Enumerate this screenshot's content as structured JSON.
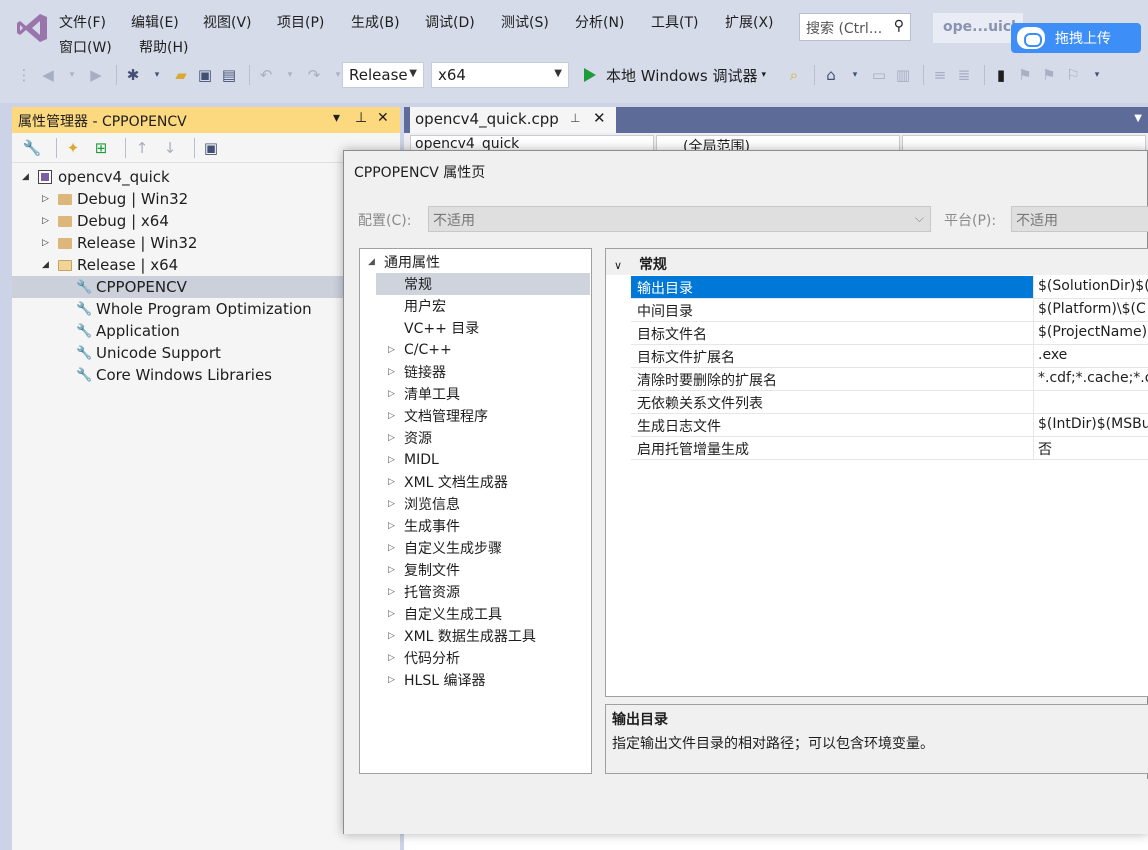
{
  "menu": [
    "文件(F)",
    "编辑(E)",
    "视图(V)",
    "项目(P)",
    "生成(B)",
    "调试(D)",
    "测试(S)",
    "分析(N)",
    "工具(T)",
    "扩展(X)",
    "窗口(W)",
    "帮助(H)"
  ],
  "search": {
    "placeholder": "搜索 (Ctrl..."
  },
  "project_badge": "ope...uick",
  "upload_button": "拖拽上传",
  "toolbar": {
    "configuration": "Release",
    "platform": "x64",
    "run_label": "本地 Windows 调试器"
  },
  "property_manager": {
    "title": "属性管理器 - CPPOPENCV",
    "pin": "ᵖ",
    "close": "✕",
    "tree": [
      {
        "label": "opencv4_quick",
        "type": "project",
        "expanded": true
      },
      {
        "label": "Debug | Win32",
        "type": "folder",
        "expanded": false
      },
      {
        "label": "Debug | x64",
        "type": "folder",
        "expanded": false
      },
      {
        "label": "Release | Win32",
        "type": "folder",
        "expanded": false
      },
      {
        "label": "Release | x64",
        "type": "folder",
        "expanded": true
      },
      {
        "label": "CPPOPENCV",
        "type": "sheet",
        "selected": true
      },
      {
        "label": "Whole Program Optimization",
        "type": "sheet"
      },
      {
        "label": "Application",
        "type": "sheet"
      },
      {
        "label": "Unicode Support",
        "type": "sheet"
      },
      {
        "label": "Core Windows Libraries",
        "type": "sheet"
      }
    ]
  },
  "editor": {
    "tab_label": "opencv4_quick.cpp",
    "nav_left": "opencv4_quick",
    "nav_mid": "(全局范围)"
  },
  "dialog": {
    "title": "CPPOPENCV 属性页",
    "config_label": "配置(C):",
    "config_value": "不适用",
    "platform_label": "平台(P):",
    "platform_value": "不适用",
    "categories": [
      {
        "label": "通用属性",
        "level": 0,
        "twisty": "expanded"
      },
      {
        "label": "常规",
        "level": 1,
        "selected": true
      },
      {
        "label": "用户宏",
        "level": 1
      },
      {
        "label": "VC++ 目录",
        "level": 1
      },
      {
        "label": "C/C++",
        "level": 1,
        "twisty": "collapsed"
      },
      {
        "label": "链接器",
        "level": 1,
        "twisty": "collapsed"
      },
      {
        "label": "清单工具",
        "level": 1,
        "twisty": "collapsed"
      },
      {
        "label": "文档管理程序",
        "level": 1,
        "twisty": "collapsed"
      },
      {
        "label": "资源",
        "level": 1,
        "twisty": "collapsed"
      },
      {
        "label": "MIDL",
        "level": 1,
        "twisty": "collapsed"
      },
      {
        "label": "XML 文档生成器",
        "level": 1,
        "twisty": "collapsed"
      },
      {
        "label": "浏览信息",
        "level": 1,
        "twisty": "collapsed"
      },
      {
        "label": "生成事件",
        "level": 1,
        "twisty": "collapsed"
      },
      {
        "label": "自定义生成步骤",
        "level": 1,
        "twisty": "collapsed"
      },
      {
        "label": "复制文件",
        "level": 1,
        "twisty": "collapsed"
      },
      {
        "label": "托管资源",
        "level": 1,
        "twisty": "collapsed"
      },
      {
        "label": "自定义生成工具",
        "level": 1,
        "twisty": "collapsed"
      },
      {
        "label": "XML 数据生成器工具",
        "level": 1,
        "twisty": "collapsed"
      },
      {
        "label": "代码分析",
        "level": 1,
        "twisty": "collapsed"
      },
      {
        "label": "HLSL 编译器",
        "level": 1,
        "twisty": "collapsed"
      }
    ],
    "section": "常规",
    "properties": [
      {
        "name": "输出目录",
        "value": "$(SolutionDir)$(",
        "selected": true
      },
      {
        "name": "中间目录",
        "value": "$(Platform)\\$(C"
      },
      {
        "name": "目标文件名",
        "value": "$(ProjectName)"
      },
      {
        "name": "目标文件扩展名",
        "value": ".exe"
      },
      {
        "name": "清除时要删除的扩展名",
        "value": "*.cdf;*.cache;*.o"
      },
      {
        "name": "无依赖关系文件列表",
        "value": ""
      },
      {
        "name": "生成日志文件",
        "value": "$(IntDir)$(MSBu"
      },
      {
        "name": "启用托管增量生成",
        "value": "否"
      }
    ],
    "description_title": "输出目录",
    "description_text": "指定输出文件目录的相对路径；可以包含环境变量。"
  }
}
